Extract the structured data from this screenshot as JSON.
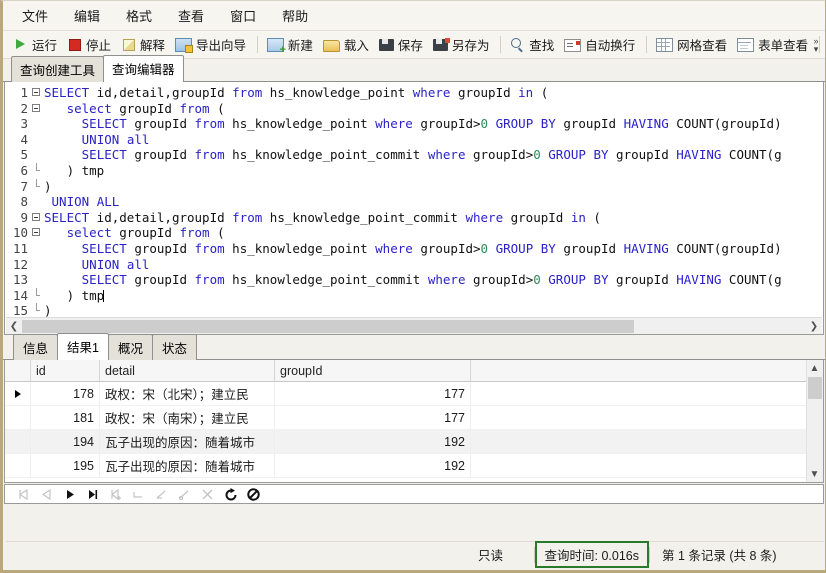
{
  "menu": {
    "items": [
      {
        "label": "文件",
        "name": "menu-file"
      },
      {
        "label": "编辑",
        "name": "menu-edit"
      },
      {
        "label": "格式",
        "name": "menu-format"
      },
      {
        "label": "查看",
        "name": "menu-view"
      },
      {
        "label": "窗口",
        "name": "menu-window"
      },
      {
        "label": "帮助",
        "name": "menu-help"
      }
    ]
  },
  "toolbar": {
    "run": "运行",
    "stop": "停止",
    "explain": "解释",
    "export_wizard": "导出向导",
    "new": "新建",
    "load": "载入",
    "save": "保存",
    "save_as": "另存为",
    "find": "查找",
    "word_wrap": "自动换行",
    "grid_view": "网格查看",
    "form_view": "表单查看",
    "overflow": "»"
  },
  "top_tabs": [
    {
      "label": "查询创建工具",
      "active": false
    },
    {
      "label": "查询编辑器",
      "active": true
    }
  ],
  "editor": {
    "lines": [
      {
        "n": 1,
        "fold": "open",
        "text": "SELECT id,detail,groupId from hs_knowledge_point where groupId in ("
      },
      {
        "n": 2,
        "fold": "open2",
        "text": "   select groupId from ("
      },
      {
        "n": 3,
        "fold": "line",
        "text": "     SELECT groupId from hs_knowledge_point where groupId>0 GROUP BY groupId HAVING COUNT(groupId)"
      },
      {
        "n": 4,
        "fold": "line",
        "text": "     UNION all"
      },
      {
        "n": 5,
        "fold": "line",
        "text": "     SELECT groupId from hs_knowledge_point_commit where groupId>0 GROUP BY groupId HAVING COUNT(g"
      },
      {
        "n": 6,
        "fold": "end2",
        "text": "   ) tmp"
      },
      {
        "n": 7,
        "fold": "end",
        "text": ")"
      },
      {
        "n": 8,
        "fold": "none",
        "text": " UNION ALL"
      },
      {
        "n": 9,
        "fold": "open",
        "text": "SELECT id,detail,groupId from hs_knowledge_point_commit where groupId in ("
      },
      {
        "n": 10,
        "fold": "open2",
        "text": "   select groupId from ("
      },
      {
        "n": 11,
        "fold": "line",
        "text": "     SELECT groupId from hs_knowledge_point where groupId>0 GROUP BY groupId HAVING COUNT(groupId)"
      },
      {
        "n": 12,
        "fold": "line",
        "text": "     UNION all"
      },
      {
        "n": 13,
        "fold": "line",
        "text": "     SELECT groupId from hs_knowledge_point_commit where groupId>0 GROUP BY groupId HAVING COUNT(g"
      },
      {
        "n": 14,
        "fold": "end2",
        "text": "   ) tmp"
      },
      {
        "n": 15,
        "fold": "end",
        "text": ")"
      }
    ]
  },
  "result_tabs": [
    {
      "label": "信息",
      "active": false
    },
    {
      "label": "结果1",
      "active": true
    },
    {
      "label": "概况",
      "active": false
    },
    {
      "label": "状态",
      "active": false
    }
  ],
  "grid": {
    "columns": [
      "id",
      "detail",
      "groupId"
    ],
    "rows": [
      {
        "marker": true,
        "id": "178",
        "detail": "政权：宋（北宋）；建立民",
        "groupId": "177"
      },
      {
        "marker": false,
        "id": "181",
        "detail": "政权：宋（南宋）；建立民",
        "groupId": "177"
      },
      {
        "marker": false,
        "id": "194",
        "detail": "瓦子出现的原因：随着城市",
        "groupId": "192"
      },
      {
        "marker": false,
        "id": "195",
        "detail": "瓦子出现的原因：随着城市",
        "groupId": "192"
      }
    ]
  },
  "nav": {
    "buttons": [
      {
        "name": "nav-first-record-icon",
        "disabled": true
      },
      {
        "name": "nav-previous-record-icon",
        "disabled": true
      },
      {
        "name": "nav-next-record-icon",
        "disabled": false
      },
      {
        "name": "nav-last-record-icon",
        "disabled": false
      },
      {
        "name": "nav-add-record-icon",
        "disabled": true
      },
      {
        "name": "nav-delete-record-icon",
        "disabled": true
      },
      {
        "name": "nav-edit-record-icon",
        "disabled": true
      },
      {
        "name": "nav-apply-changes-icon",
        "disabled": true
      },
      {
        "name": "nav-cancel-changes-icon",
        "disabled": true
      },
      {
        "name": "nav-refresh-icon",
        "disabled": false
      },
      {
        "name": "nav-stop-icon",
        "disabled": false
      }
    ]
  },
  "status": {
    "readonly": "只读",
    "query_time": "查询时间: 0.016s",
    "records": "第 1 条记录 (共 8 条)",
    "highlight_color": "#2b7a2b"
  }
}
